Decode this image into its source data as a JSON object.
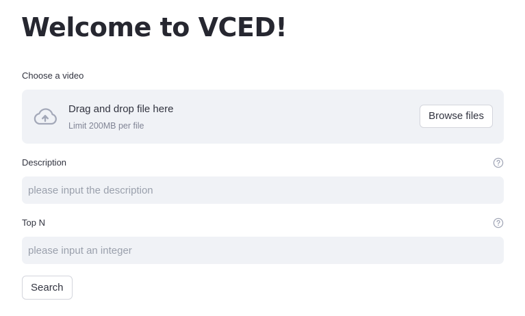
{
  "page": {
    "title": "Welcome to VCED!"
  },
  "uploader": {
    "label": "Choose a video",
    "drop_text": "Drag and drop file here",
    "limit_text": "Limit 200MB per file",
    "browse_label": "Browse files",
    "icon": "cloud-upload-icon"
  },
  "description": {
    "label": "Description",
    "placeholder": "please input the description",
    "value": "",
    "help_icon": "help-circle-icon"
  },
  "top_n": {
    "label": "Top N",
    "placeholder": "please input an integer",
    "value": "",
    "help_icon": "help-circle-icon"
  },
  "search": {
    "label": "Search"
  },
  "colors": {
    "text": "#31333f",
    "input_bg": "#f0f2f6",
    "muted": "#808495",
    "icon": "#a3a8b8"
  }
}
